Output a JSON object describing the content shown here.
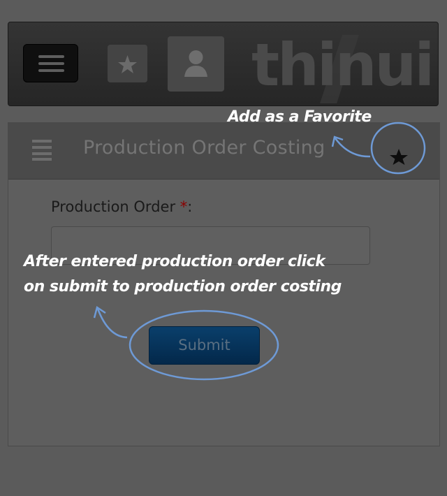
{
  "header": {
    "logo_text": "thinui",
    "menu_icon": "hamburger-icon",
    "favorite_icon": "star-icon",
    "profile_icon": "user-icon"
  },
  "page": {
    "title": "Production Order Costing",
    "list_icon": "list-icon",
    "favorite_icon": "star-icon"
  },
  "form": {
    "field_label": "Production Order ",
    "required_mark": "*",
    "label_colon": ":",
    "input_value": "",
    "submit_label": "Submit"
  },
  "annotations": {
    "favorite_note": "Add as a Favorite",
    "submit_note_line1": "After entered production order click",
    "submit_note_line2": "on submit to production order costing",
    "highlight_color": "#6e9ad6"
  }
}
